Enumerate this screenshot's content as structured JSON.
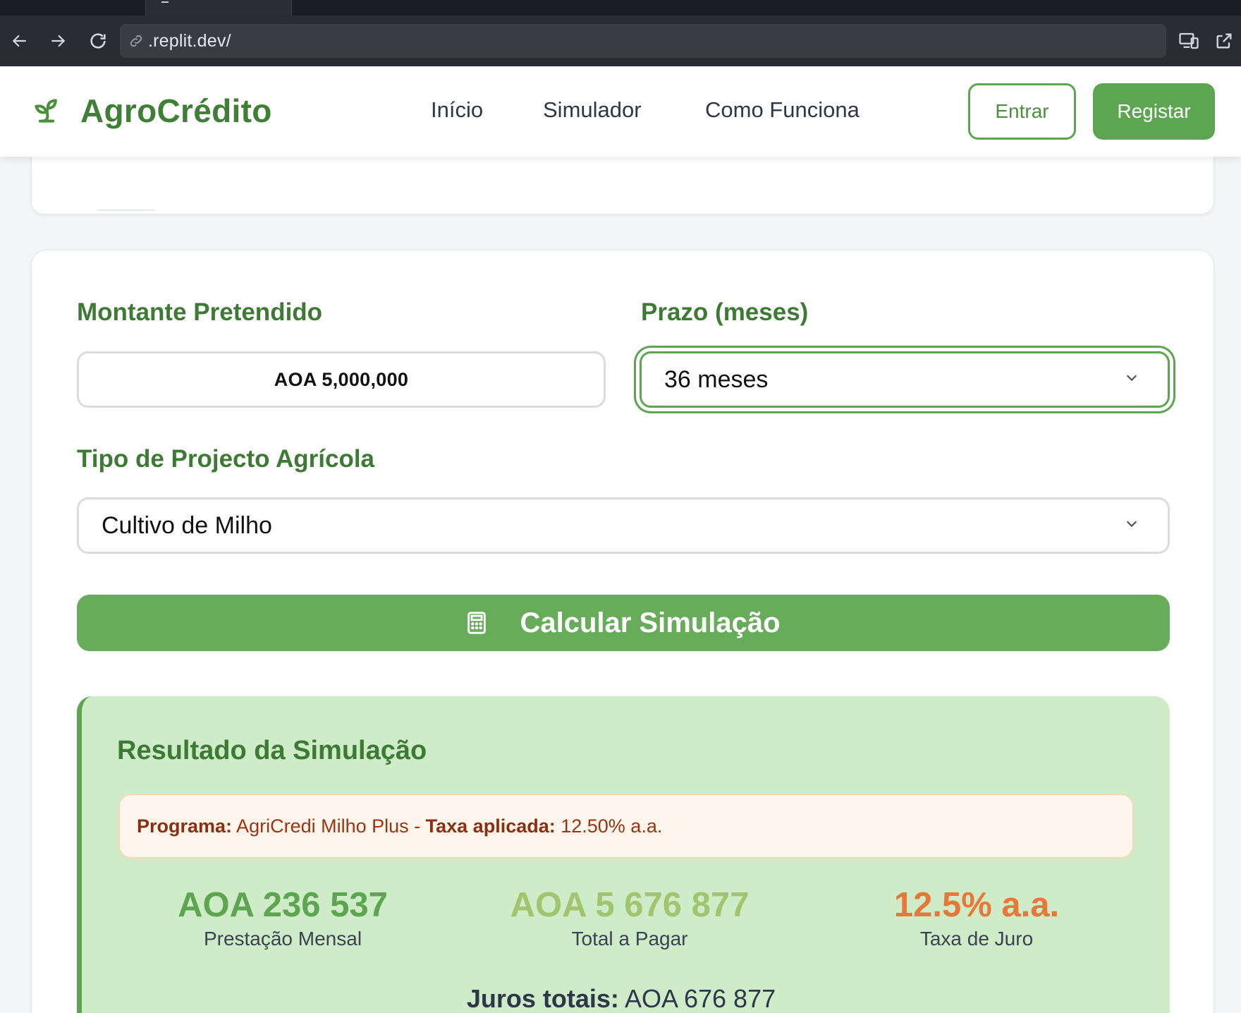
{
  "browser": {
    "url": ".replit.dev/"
  },
  "header": {
    "brand": "AgroCrédito",
    "nav": [
      "Início",
      "Simulador",
      "Como Funciona"
    ],
    "login_label": "Entrar",
    "register_label": "Registar"
  },
  "form": {
    "amount_label": "Montante Pretendido",
    "amount_value": "AOA 5,000,000",
    "term_label": "Prazo (meses)",
    "term_value": "36 meses",
    "project_label": "Tipo de Projecto Agrícola",
    "project_value": "Cultivo de Milho",
    "calculate_label": "Calcular Simulação"
  },
  "result": {
    "title": "Resultado da Simulação",
    "program_label": "Programa:",
    "program_value": " AgriCredi Milho Plus - ",
    "rate_label": "Taxa aplicada:",
    "rate_value": " 12.50% a.a.",
    "stats": [
      {
        "value": "AOA 236 537",
        "label": "Prestação Mensal",
        "color": "#5ea552"
      },
      {
        "value": "AOA 5 676 877",
        "label": "Total a Pagar",
        "color": "#a3c46f"
      },
      {
        "value": "12.5% a.a.",
        "label": "Taxa de Juro",
        "color": "#e8773a"
      }
    ],
    "total_interest_label": "Juros totais:",
    "total_interest_value": " AOA 676 877"
  },
  "colors": {
    "primary": "#5ea552",
    "brand_text": "#3f7f36",
    "result_bg": "#cdecc7"
  }
}
